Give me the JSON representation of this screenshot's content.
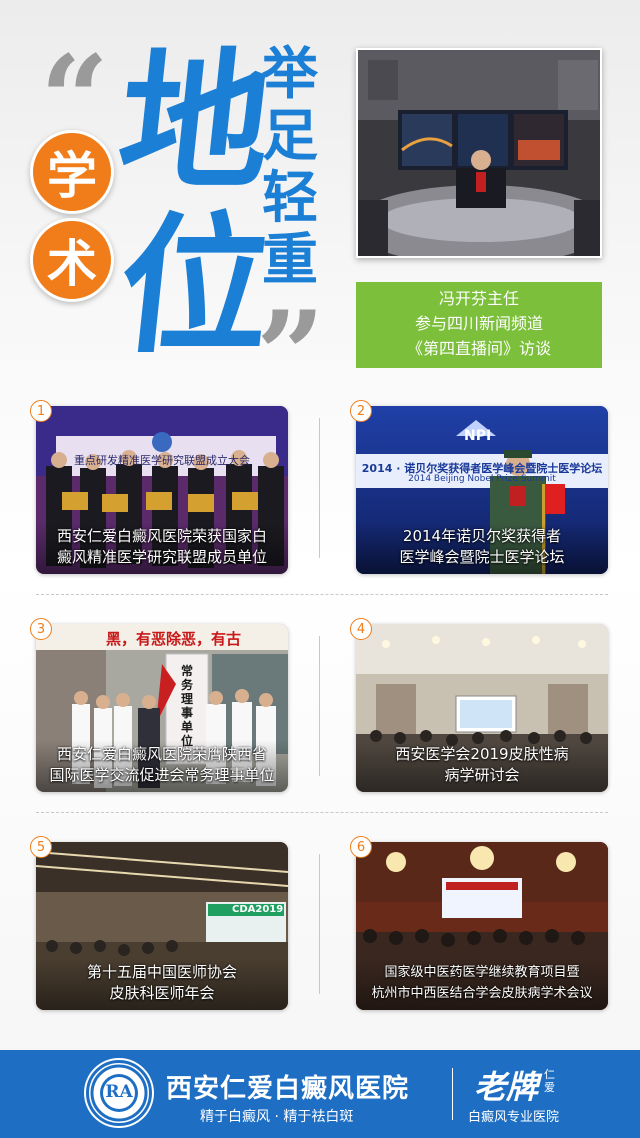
{
  "header": {
    "quote_open": "“",
    "quote_close": "”",
    "big_chars": [
      "地",
      "位"
    ],
    "circle_chars": [
      "学",
      "术"
    ],
    "vertical_title": [
      "举",
      "足",
      "轻",
      "重"
    ]
  },
  "interview": {
    "lines": [
      "冯开芬主任",
      "参与四川新闻频道",
      "《第四直播间》访谈"
    ]
  },
  "cards": [
    {
      "num": "1",
      "caption_lines": [
        "西安仁爱白癜风医院荣获国家白",
        "癜风精准医学研究联盟成员单位"
      ],
      "sign_text": "重点研发精准医学研究联盟成立大会"
    },
    {
      "num": "2",
      "caption_lines": [
        "2014年诺贝尔奖获得者",
        "医学峰会暨院士医学论坛"
      ],
      "sign_text": "2014 · 诺贝尔奖获得者医学峰会暨院士医学论坛",
      "sign_sub": "2014 Beijing Nobel Prize Summit",
      "logo_text": "NPI"
    },
    {
      "num": "3",
      "caption_lines": [
        "西安仁爱白癜风医院荣膺陕西省",
        "国际医学交流促进会常务理事单位"
      ],
      "banner_text": "黑，有恶除恶，有古",
      "plaque_text": "常务理事单位"
    },
    {
      "num": "4",
      "caption_lines": [
        "西安医学会2019皮肤性病",
        "病学研讨会"
      ]
    },
    {
      "num": "5",
      "caption_lines": [
        "第十五届中国医师协会",
        "皮肤科医师年会"
      ],
      "screen_text": "CDA2019"
    },
    {
      "num": "6",
      "caption_lines": [
        "国家级中医药医学继续教育项目暨",
        "杭州市中西医结合学会皮肤病学术会议"
      ]
    }
  ],
  "footer": {
    "logo_text": "RA",
    "hospital_name": "西安仁爱白癜风医院",
    "slogan": "精于白癜风 · 精于祛白斑",
    "brand": "老牌",
    "brand_small": "仁爱",
    "brand_sub": "白癜风专业医院"
  },
  "colors": {
    "blue": "#1b7fd6",
    "orange": "#f07d1a",
    "green": "#7bbf3a",
    "footer_blue": "#1e6fc4"
  }
}
